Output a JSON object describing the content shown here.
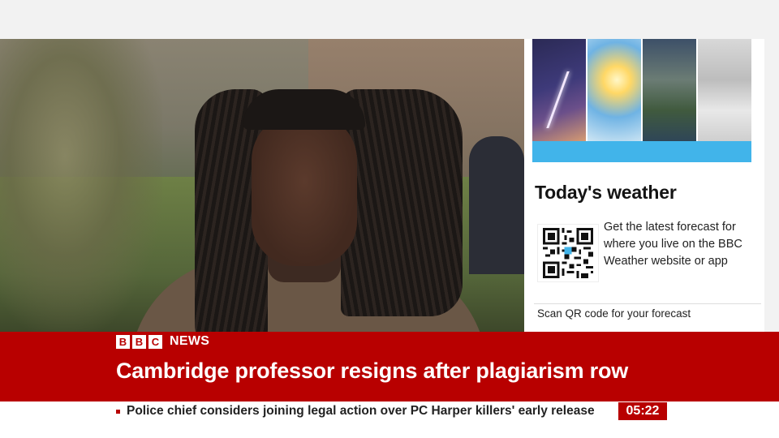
{
  "weather_panel": {
    "title": "Today's weather",
    "description": "Get the latest forecast for where you live on the BBC Weather website or app",
    "scan_text": "Scan QR code for your forecast",
    "accent_color": "#41b4ea",
    "tile_icons": [
      "thunderstorm-image",
      "sunshine-image",
      "cloud-image",
      "frost-image"
    ]
  },
  "banner": {
    "brand_letters": [
      "B",
      "B",
      "C"
    ],
    "brand_word": "NEWS",
    "headline": "Cambridge professor resigns after plagiarism row",
    "color": "#b80000"
  },
  "ticker": {
    "text": "Police chief considers joining legal action over PC Harper killers' early release",
    "time": "05:22"
  }
}
